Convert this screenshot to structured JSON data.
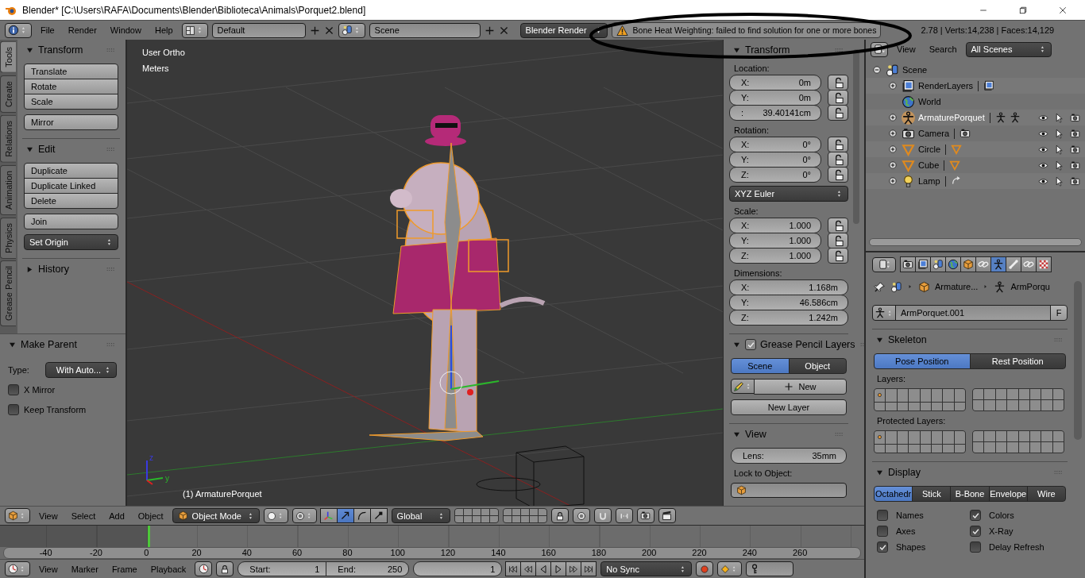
{
  "title_bar": {
    "title": "Blender* [C:\\Users\\RAFA\\Documents\\Blender\\Biblioteca\\Animals\\Porquet2.blend]"
  },
  "info_header": {
    "menus": [
      "File",
      "Render",
      "Window",
      "Help"
    ],
    "layout": "Default",
    "scene": "Scene",
    "engine": "Blender Render",
    "warning": "Bone Heat Weighting: failed to find solution for one or more bones",
    "stats": "2.78 | Verts:14,238 | Faces:14,129"
  },
  "tool_tabs": [
    {
      "label": "Tools",
      "selected": true
    },
    {
      "label": "Create",
      "selected": false
    },
    {
      "label": "Relations",
      "selected": false
    },
    {
      "label": "Animation",
      "selected": false
    },
    {
      "label": "Physics",
      "selected": false
    },
    {
      "label": "Grease Pencil",
      "selected": false
    }
  ],
  "tool_panels": [
    {
      "title": "Transform",
      "expanded": true,
      "groups": [
        {
          "kind": "buttons",
          "items": [
            "Translate",
            "Rotate",
            "Scale"
          ]
        },
        {
          "kind": "buttons",
          "items": [
            "Mirror"
          ]
        }
      ]
    },
    {
      "title": "Edit",
      "expanded": true,
      "groups": [
        {
          "kind": "buttons",
          "items": [
            "Duplicate",
            "Duplicate Linked",
            "Delete"
          ]
        },
        {
          "kind": "buttons",
          "items": [
            "Join"
          ]
        },
        {
          "kind": "dropdown",
          "items": [
            "Set Origin"
          ]
        }
      ]
    },
    {
      "title": "History",
      "expanded": false
    }
  ],
  "operator_panel": {
    "title": "Make Parent",
    "expanded": true,
    "type_label": "Type:",
    "type_value": "With Auto...",
    "options": [
      {
        "label": "X Mirror",
        "checked": false
      },
      {
        "label": "Keep Transform",
        "checked": false
      }
    ]
  },
  "viewport": {
    "view_name": "User Ortho",
    "units": "Meters",
    "axis_labels": [
      "z",
      "y"
    ],
    "active_object": "(1) ArmaturePorquet"
  },
  "n_panel": {
    "transform": {
      "title": "Transform",
      "expanded": true,
      "sections": [
        {
          "label": "Location:",
          "fields": [
            {
              "axis": "X:",
              "value": "0m",
              "locked": false
            },
            {
              "axis": "Y:",
              "value": "0m",
              "locked": false
            },
            {
              "axis": ":",
              "value": "39.40141cm",
              "locked": false
            }
          ]
        },
        {
          "label": "Rotation:",
          "fields": [
            {
              "axis": "X:",
              "value": "0°",
              "locked": false
            },
            {
              "axis": "Y:",
              "value": "0°",
              "locked": false
            },
            {
              "axis": "Z:",
              "value": "0°",
              "locked": false
            }
          ],
          "mode": "XYZ Euler"
        },
        {
          "label": "Scale:",
          "fields": [
            {
              "axis": "X:",
              "value": "1.000",
              "locked": false
            },
            {
              "axis": "Y:",
              "value": "1.000",
              "locked": false
            },
            {
              "axis": "Z:",
              "value": "1.000",
              "locked": false
            }
          ]
        },
        {
          "label": "Dimensions:",
          "fields": [
            {
              "axis": "X:",
              "value": "1.168m"
            },
            {
              "axis": "Y:",
              "value": "46.586cm"
            },
            {
              "axis": "Z:",
              "value": "1.242m"
            }
          ]
        }
      ]
    },
    "grease_pencil": {
      "title": "Grease Pencil Layers",
      "enabled": true,
      "expanded": true,
      "sources": [
        {
          "label": "Scene",
          "selected": true
        },
        {
          "label": "Object",
          "selected": false
        }
      ],
      "new": "New",
      "new_layer": "New Layer"
    },
    "view": {
      "title": "View",
      "expanded": true,
      "lens_label": "Lens:",
      "lens": "35mm",
      "lock_label": "Lock to Object:"
    }
  },
  "view3d_header": {
    "menus": [
      "View",
      "Select",
      "Add",
      "Object"
    ],
    "mode": "Object Mode",
    "manipulators": [
      {
        "kind": "axes",
        "on": false
      },
      {
        "kind": "translate",
        "on": true
      },
      {
        "kind": "rotate",
        "on": false
      },
      {
        "kind": "scale",
        "on": false
      }
    ],
    "orientation": "Global"
  },
  "timeline": {
    "ticks": [
      "-40",
      "-20",
      "0",
      "20",
      "40",
      "60",
      "80",
      "100",
      "120",
      "140",
      "160",
      "180",
      "200",
      "220",
      "240",
      "260"
    ]
  },
  "timeline_header": {
    "menus": [
      "View",
      "Marker",
      "Frame",
      "Playback"
    ],
    "start_label": "Start:",
    "start": "1",
    "end_label": "End:",
    "end": "250",
    "frame": "1",
    "sync": "No Sync"
  },
  "outliner": {
    "menus": [
      "View",
      "Search"
    ],
    "filter": "All Scenes",
    "tree": [
      {
        "name": "Scene",
        "kind": "scene",
        "expanded": true,
        "selected": false,
        "children": [
          {
            "name": "RenderLayers",
            "kind": "renderlayers",
            "expanded": false,
            "selected": false
          },
          {
            "name": "World",
            "kind": "world",
            "selected": false
          },
          {
            "name": "ArmaturePorquet",
            "kind": "armature",
            "expanded": false,
            "selected": true
          },
          {
            "name": "Camera",
            "kind": "camera",
            "expanded": false,
            "selected": false
          },
          {
            "name": "Circle",
            "kind": "mesh",
            "expanded": false,
            "selected": false
          },
          {
            "name": "Cube",
            "kind": "mesh",
            "expanded": false,
            "selected": false
          },
          {
            "name": "Lamp",
            "kind": "lamp",
            "expanded": false,
            "selected": false
          }
        ]
      }
    ]
  },
  "properties": {
    "tabs": [
      {
        "kind": "render",
        "selected": false
      },
      {
        "kind": "renderlayers",
        "selected": false
      },
      {
        "kind": "scene",
        "selected": false
      },
      {
        "kind": "world",
        "selected": false
      },
      {
        "kind": "object",
        "selected": false
      },
      {
        "kind": "constraints",
        "selected": false
      },
      {
        "kind": "data",
        "selected": true
      },
      {
        "kind": "bone",
        "selected": false
      },
      {
        "kind": "boneconstraints",
        "selected": false
      },
      {
        "kind": "texture",
        "selected": false
      }
    ],
    "breadcrumb": [
      "Armature...",
      "ArmPorqu"
    ],
    "datablock": "ArmPorquet.001",
    "fake_user": "F",
    "skeleton": {
      "title": "Skeleton",
      "expanded": true,
      "positions": [
        {
          "label": "Pose Position",
          "selected": true
        },
        {
          "label": "Rest Position",
          "selected": false
        }
      ],
      "layers_label": "Layers:",
      "protected_label": "Protected Layers:"
    },
    "display": {
      "title": "Display",
      "expanded": true,
      "types": [
        {
          "label": "Octahedr",
          "selected": true
        },
        {
          "label": "Stick",
          "selected": false
        },
        {
          "label": "B-Bone",
          "selected": false
        },
        {
          "label": "Envelope",
          "selected": false
        },
        {
          "label": "Wire",
          "selected": false
        }
      ],
      "options": [
        {
          "label": "Names",
          "checked": false
        },
        {
          "label": "Colors",
          "checked": true
        },
        {
          "label": "Axes",
          "checked": false
        },
        {
          "label": "X-Ray",
          "checked": true
        },
        {
          "label": "Shapes",
          "checked": true
        },
        {
          "label": "Delay Refresh",
          "checked": false
        }
      ]
    }
  }
}
